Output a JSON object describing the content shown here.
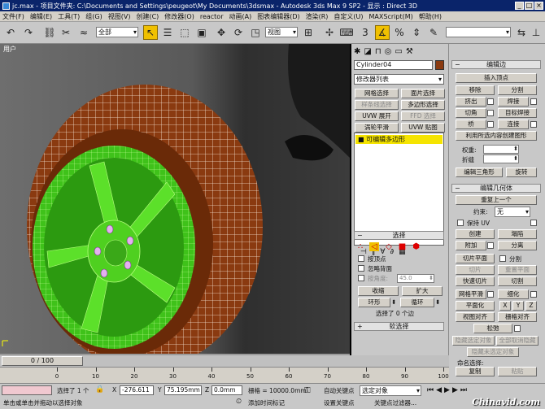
{
  "window": {
    "title": "jc.max - 项目文件夹: C:\\Documents and Settings\\peugeot\\My Documents\\3dsmax - Autodesk 3ds Max 9 SP2 - 显示 : Direct 3D",
    "buttons": [
      "_",
      "□",
      "×"
    ]
  },
  "menu": {
    "items": [
      "文件(F)",
      "编辑(E)",
      "工具(T)",
      "组(G)",
      "视图(V)",
      "创建(C)",
      "修改器(O)",
      "reactor",
      "动画(A)",
      "图表编辑器(D)",
      "渲染(R)",
      "自定义(U)",
      "MAXScript(M)",
      "帮助(H)"
    ]
  },
  "toolbar": {
    "selection_filter": "全部",
    "ref_coord": "视图",
    "named_sel": ""
  },
  "viewport": {
    "label": "用户"
  },
  "command_panel": {
    "object_name": "Cylinder04",
    "object_color": "#8a3a10",
    "modifier_list": "修改器列表",
    "mod_buttons": [
      {
        "label": "网格选择",
        "enabled": true
      },
      {
        "label": "面片选择",
        "enabled": true
      },
      {
        "label": "样条线选择",
        "enabled": false
      },
      {
        "label": "多边形选择",
        "enabled": true
      },
      {
        "label": "UVW 展开",
        "enabled": true
      },
      {
        "label": "FFD 选择",
        "enabled": false
      },
      {
        "label": "涡轮平滑",
        "enabled": true
      },
      {
        "label": "UVW 贴图",
        "enabled": true
      }
    ],
    "stack_item": "可编辑多边形",
    "stack_icons": [
      "⊣",
      "‖",
      "∀",
      "∂",
      "▦"
    ],
    "selection": {
      "title": "选择",
      "by_vertex": "按顶点",
      "ignore_backfacing": "忽略背面",
      "by_angle": "按角度:",
      "angle_value": "45.0",
      "shrink": "收缩",
      "grow": "扩大",
      "ring": "环形",
      "loop": "循环",
      "status": "选择了 0 个边"
    },
    "soft_selection": "软选择"
  },
  "rollout": {
    "edit_edges": {
      "title": "编辑边",
      "insert_vertex": "插入顶点",
      "remove": "移除",
      "split": "分割",
      "extrude": "挤出",
      "weld": "焊接",
      "chamfer": "切角",
      "target_weld": "目标焊接",
      "bridge": "桥",
      "connect": "连接",
      "create_shape": "利用所选内容创建图形",
      "weight": "权重:",
      "crease": "折缝",
      "edit_tri": "编辑三角形",
      "turn": "旋转"
    },
    "edit_geometry": {
      "title": "编辑几何体",
      "repeat_last": "重复上一个",
      "constraint": "约束:",
      "constraint_value": "无",
      "preserve_uvs": "保持 UV",
      "create": "创建",
      "collapse": "塌陷",
      "attach": "附加",
      "detach": "分离",
      "slice_plane": "切片平面",
      "split": "分割",
      "slice": "切片",
      "reset_plane": "重置平面",
      "quickslice": "快速切片",
      "cut": "切割",
      "meshsmooth": "网格平滑",
      "tessellate": "细化",
      "make_planar": "平面化",
      "x": "X",
      "y": "Y",
      "z": "Z",
      "view_align": "视图对齐",
      "grid_align": "栅格对齐",
      "relax": "松弛",
      "hide_selected": "隐藏选定对象",
      "unhide_all": "全部取消隐藏",
      "hide_unselected": "隐藏未选定对象",
      "named_selections": "命名选择:",
      "copy": "复制",
      "paste": "粘贴",
      "delete_isolated": "删除孤立顶点"
    }
  },
  "timeline": {
    "position": "0 / 100",
    "ticks": [
      "0",
      "10",
      "20",
      "30",
      "40",
      "50",
      "60",
      "70",
      "80",
      "90",
      "100"
    ]
  },
  "status": {
    "selection": "选择了 1 个",
    "prompt": "单击或单击并拖动以选择对象",
    "x_label": "X",
    "x_value": "-276.611",
    "y_label": "Y",
    "y_value": "75.195mm",
    "z_label": "Z",
    "z_value": "0.0mm",
    "grid": "栅格 = 10000.0mm",
    "add_time_tag": "添加时间标记",
    "auto_key": "自动关键点",
    "set_key": "设置关键点",
    "selected_obj": "选定对象",
    "key_filters": "关键点过滤器..."
  },
  "watermark": "Chinavid.com"
}
